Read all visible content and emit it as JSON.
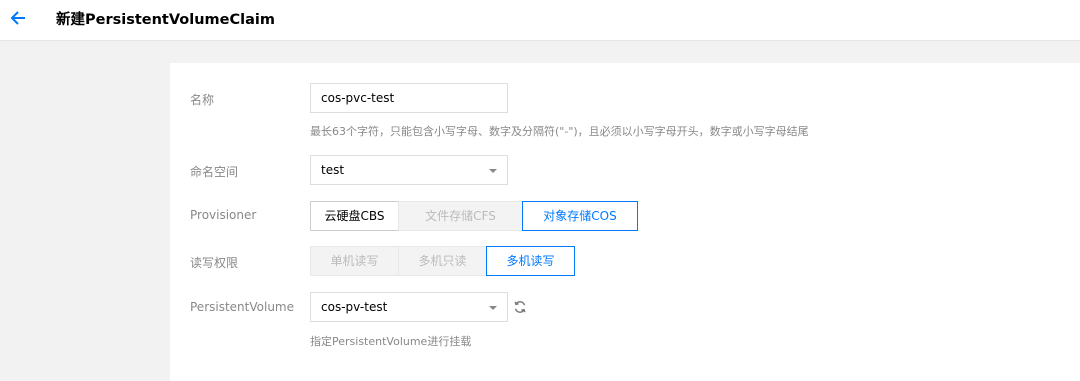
{
  "header": {
    "title": "新建PersistentVolumeClaim",
    "back_icon": "arrow-left-icon",
    "accent_color": "#0079ff"
  },
  "form": {
    "name": {
      "label": "名称",
      "value": "cos-pvc-test",
      "hint": "最长63个字符，只能包含小写字母、数字及分隔符(\"-\")，且必须以小写字母开头，数字或小写字母结尾"
    },
    "namespace": {
      "label": "命名空间",
      "value": "test"
    },
    "provisioner": {
      "label": "Provisioner",
      "options": [
        "云硬盘CBS",
        "文件存储CFS",
        "对象存储COS"
      ],
      "selected": "对象存储COS"
    },
    "access_mode": {
      "label": "读写权限",
      "options": [
        "单机读写",
        "多机只读",
        "多机读写"
      ],
      "selected": "多机读写"
    },
    "persistent_volume": {
      "label": "PersistentVolume",
      "value": "cos-pv-test",
      "hint": "指定PersistentVolume进行挂载",
      "refresh_icon": "refresh-icon"
    }
  }
}
